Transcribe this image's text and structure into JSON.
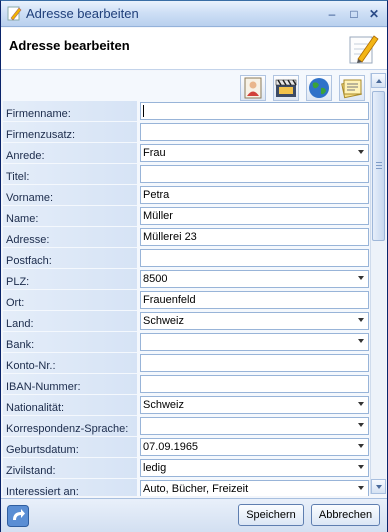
{
  "window": {
    "title": "Adresse bearbeiten",
    "icon": "pencil-note-icon"
  },
  "header": {
    "title": "Adresse bearbeiten",
    "icon": "pencil-note-icon"
  },
  "toolbar": {
    "icons": [
      "person-card-icon",
      "film-clapper-icon",
      "globe-icon",
      "notes-icon"
    ]
  },
  "form": {
    "fields": [
      {
        "label": "Firmenname:",
        "value": "",
        "type": "text",
        "focused": true
      },
      {
        "label": "Firmenzusatz:",
        "value": "",
        "type": "text"
      },
      {
        "label": "Anrede:",
        "value": "Frau",
        "type": "select"
      },
      {
        "label": "Titel:",
        "value": "",
        "type": "text"
      },
      {
        "label": "Vorname:",
        "value": "Petra",
        "type": "text"
      },
      {
        "label": "Name:",
        "value": "Müller",
        "type": "text"
      },
      {
        "label": "Adresse:",
        "value": "Müllerei 23",
        "type": "text"
      },
      {
        "label": "Postfach:",
        "value": "",
        "type": "text"
      },
      {
        "label": "PLZ:",
        "value": "8500",
        "type": "select"
      },
      {
        "label": "Ort:",
        "value": "Frauenfeld",
        "type": "text"
      },
      {
        "label": "Land:",
        "value": "Schweiz",
        "type": "select"
      },
      {
        "label": "Bank:",
        "value": "",
        "type": "select"
      },
      {
        "label": "Konto-Nr.:",
        "value": "",
        "type": "text"
      },
      {
        "label": "IBAN-Nummer:",
        "value": "",
        "type": "text"
      },
      {
        "label": "Nationalität:",
        "value": "Schweiz",
        "type": "select"
      },
      {
        "label": "Korrespondenz-Sprache:",
        "value": "",
        "type": "select"
      },
      {
        "label": "Geburtsdatum:",
        "value": "07.09.1965",
        "type": "select"
      },
      {
        "label": "Zivilstand:",
        "value": "ledig",
        "type": "select"
      },
      {
        "label": "Interessiert an:",
        "value": "Auto, Bücher, Freizeit",
        "type": "select"
      }
    ]
  },
  "footer": {
    "save_label": "Speichern",
    "cancel_label": "Abbrechen",
    "left_icon": "refresh-icon"
  },
  "colors": {
    "titlebar": "#cfe0f6",
    "label_background": "#dde8f7",
    "field_border": "#98b4d8",
    "button_border": "#5e7eb0"
  }
}
